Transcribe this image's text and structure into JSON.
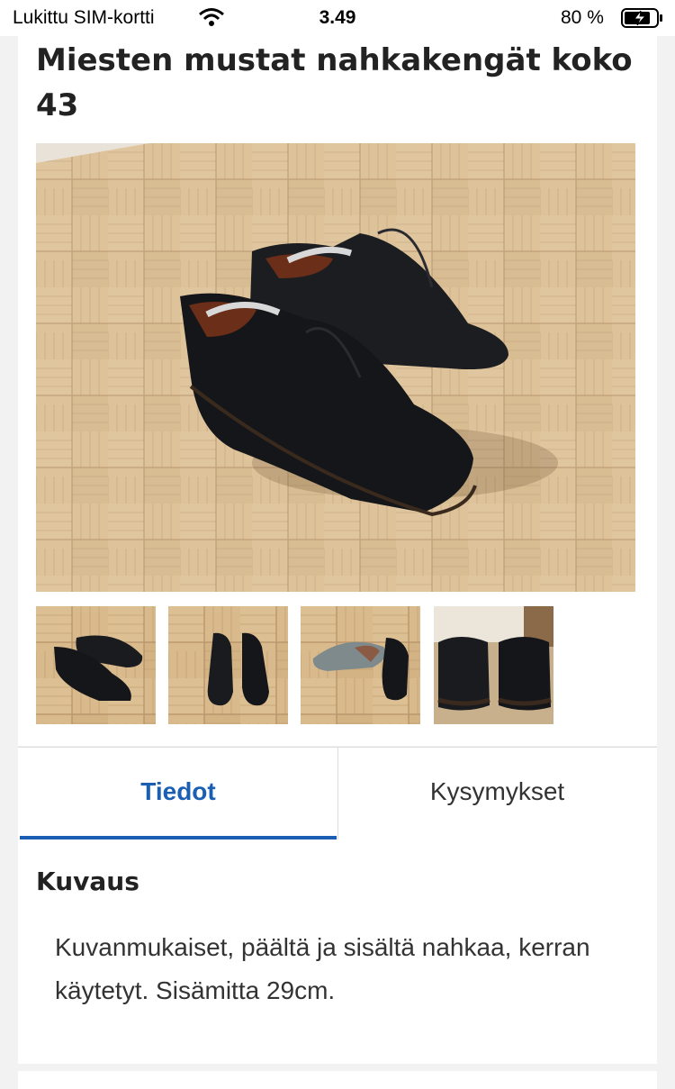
{
  "status_bar": {
    "carrier": "Lukittu SIM-kortti",
    "time": "3.49",
    "battery": "80 %"
  },
  "listing": {
    "title": "Miesten mustat nahkakengät koko 43",
    "main_photo": "black-leather-shoes-on-parquet-photo",
    "thumbnails": [
      "shoes-side-view-thumbnail",
      "shoes-front-view-thumbnail",
      "shoe-sole-thumbnail",
      "shoes-heel-view-thumbnail"
    ]
  },
  "tabs": [
    {
      "label": "Tiedot",
      "active": true
    },
    {
      "label": "Kysymykset",
      "active": false
    }
  ],
  "description": {
    "heading": "Kuvaus",
    "text": "Kuvanmukaiset, päältä ja sisältä nahkaa, kerran käytetyt. Sisämitta 29cm."
  },
  "colors": {
    "accent": "#1a5fb4",
    "background": "#f2f2f2",
    "card": "#ffffff",
    "floor": "#d6b588"
  }
}
